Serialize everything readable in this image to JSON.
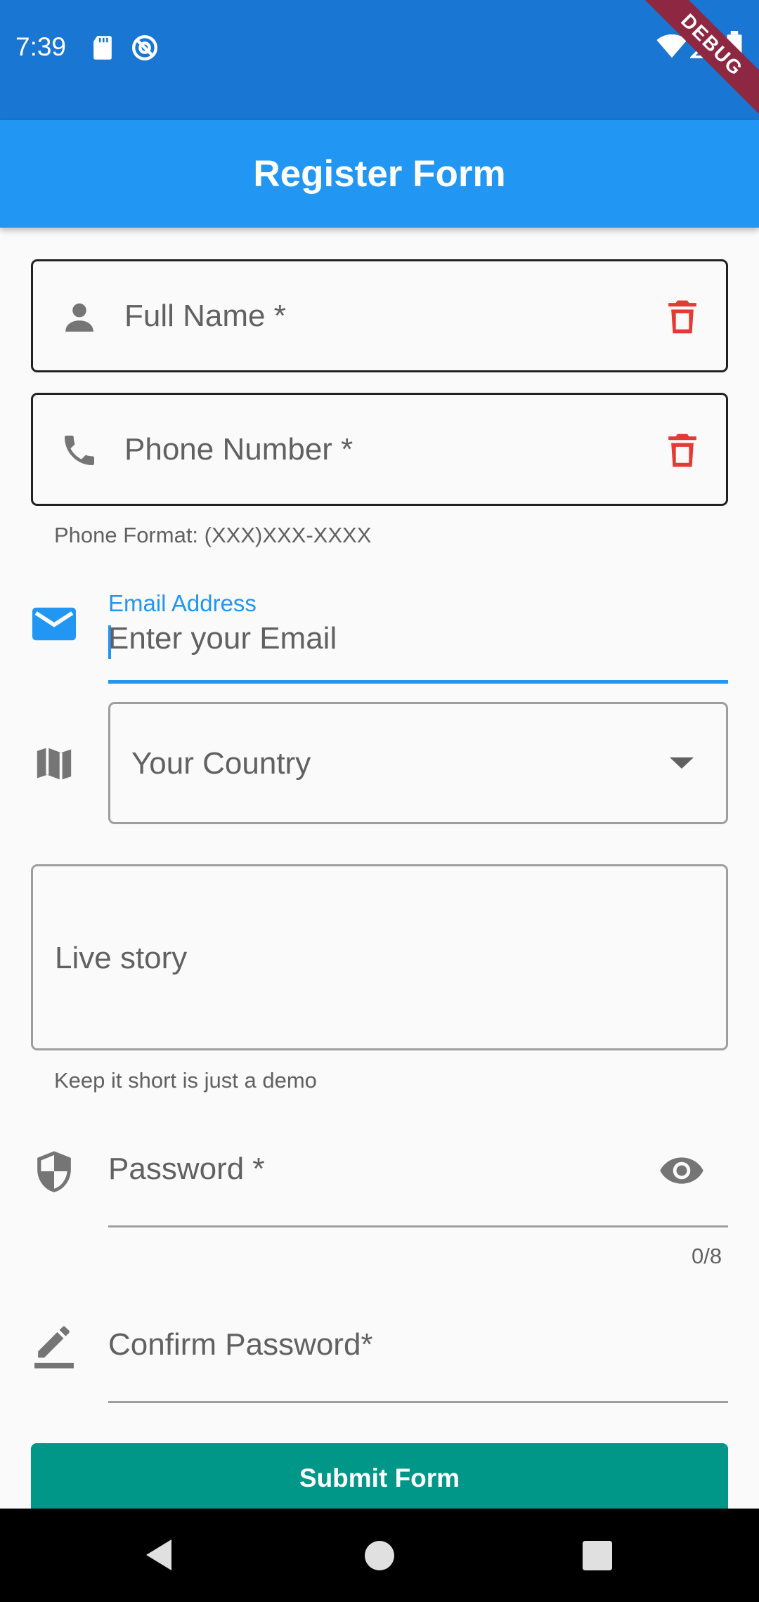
{
  "status_bar": {
    "time": "7:39",
    "debug_label": "DEBUG"
  },
  "app_bar": {
    "title": "Register Form"
  },
  "form": {
    "full_name": {
      "label": "Full Name *",
      "icon": "person-icon",
      "clear_icon": "delete-icon"
    },
    "phone": {
      "label": "Phone Number *",
      "icon": "phone-icon",
      "clear_icon": "delete-icon",
      "helper": "Phone Format: (XXX)XXX-XXXX"
    },
    "email": {
      "floating_label": "Email Address",
      "placeholder": "Enter your Email",
      "icon": "email-icon"
    },
    "country": {
      "hint": "Your Country",
      "icon": "map-icon"
    },
    "story": {
      "label": "Live story",
      "helper": "Keep it short is just a demo"
    },
    "password": {
      "label": "Password *",
      "icon": "shield-icon",
      "counter": "0/8",
      "toggle_icon": "eye-icon"
    },
    "confirm_password": {
      "label": "Confirm Password*",
      "icon": "edit-icon"
    },
    "submit_label": "Submit Form"
  },
  "colors": {
    "status_bar": "#1976d2",
    "app_bar": "#2196f3",
    "accent": "#2196f3",
    "danger": "#e53935",
    "submit": "#009688"
  }
}
